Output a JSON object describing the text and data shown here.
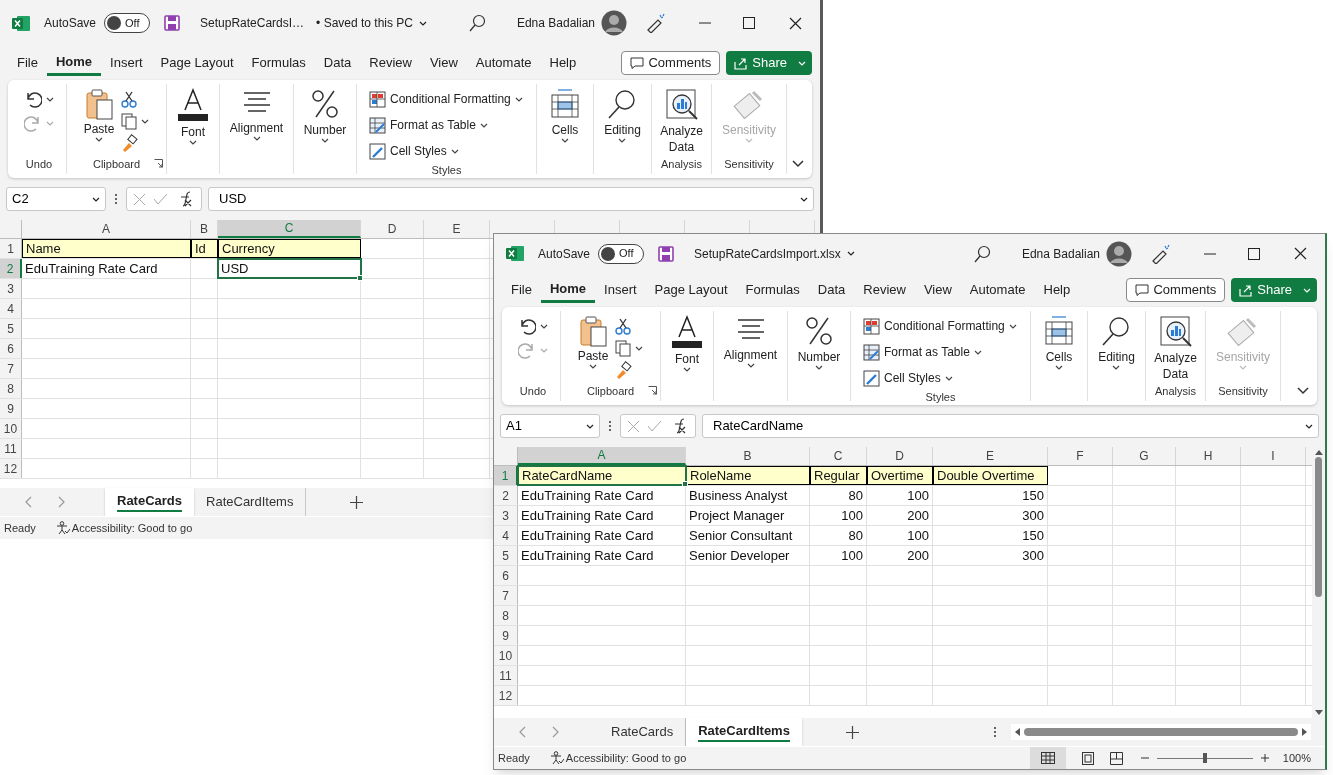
{
  "windows": [
    {
      "autosave": {
        "label": "AutoSave",
        "on": false,
        "state": "Off"
      },
      "filename": "SetupRateCardsI…",
      "save_status": "• Saved to this PC",
      "user": "Edna Badalian",
      "menu_tabs": [
        {
          "label": "File",
          "selected": false
        },
        {
          "label": "Home",
          "selected": true
        },
        {
          "label": "Insert",
          "selected": false
        },
        {
          "label": "Page Layout",
          "selected": false
        },
        {
          "label": "Formulas",
          "selected": false
        },
        {
          "label": "Data",
          "selected": false
        },
        {
          "label": "Review",
          "selected": false
        },
        {
          "label": "View",
          "selected": false
        },
        {
          "label": "Automate",
          "selected": false
        },
        {
          "label": "Help",
          "selected": false
        }
      ],
      "comments": "Comments",
      "share": "Share",
      "ribbon": [
        {
          "kind": "undo",
          "label": "Undo"
        },
        {
          "kind": "clipboard",
          "label": "Clipboard",
          "button": "Paste"
        },
        {
          "kind": "font",
          "button": "Font"
        },
        {
          "kind": "alignment",
          "button": "Alignment"
        },
        {
          "kind": "number",
          "button": "Number"
        },
        {
          "kind": "styles",
          "label": "Styles",
          "items": [
            "Conditional Formatting",
            "Format as Table",
            "Cell Styles"
          ]
        },
        {
          "kind": "cells",
          "button": "Cells"
        },
        {
          "kind": "editing",
          "button": "Editing"
        },
        {
          "kind": "analyze",
          "label": "Analysis",
          "button": "Analyze Data",
          "disabled": false
        },
        {
          "kind": "sensitivity",
          "label": "Sensitivity",
          "button": "Sensitivity",
          "disabled": true
        }
      ],
      "name_box": "C2",
      "formula": "USD",
      "columns": [
        {
          "label": "A",
          "selected": false
        },
        {
          "label": "B",
          "selected": false
        },
        {
          "label": "C",
          "selected": true
        },
        {
          "label": "D",
          "selected": false
        },
        {
          "label": "E",
          "selected": false
        }
      ],
      "rows": [
        {
          "label": "1",
          "selected": false,
          "header": true,
          "cells": [
            "Name",
            "Id",
            "Currency"
          ]
        },
        {
          "label": "2",
          "selected": true,
          "header": false,
          "cells": [
            "EduTraining Rate Card",
            null,
            "USD"
          ]
        },
        {
          "label": "3",
          "selected": false
        },
        {
          "label": "4",
          "selected": false
        },
        {
          "label": "5",
          "selected": false
        },
        {
          "label": "6",
          "selected": false
        },
        {
          "label": "7",
          "selected": false
        },
        {
          "label": "8",
          "selected": false
        },
        {
          "label": "9",
          "selected": false
        },
        {
          "label": "10",
          "selected": false
        },
        {
          "label": "11",
          "selected": false
        },
        {
          "label": "12",
          "selected": false
        }
      ],
      "sheets": [
        {
          "label": "RateCards",
          "selected": true
        },
        {
          "label": "RateCardItems",
          "selected": false
        }
      ],
      "status": "Ready",
      "accessibility": "Accessibility: Good to go"
    },
    {
      "autosave": {
        "label": "AutoSave",
        "on": false,
        "state": "Off"
      },
      "filename": "SetupRateCardsImport.xlsx",
      "user": "Edna Badalian",
      "menu_tabs": [
        {
          "label": "File",
          "selected": false
        },
        {
          "label": "Home",
          "selected": true
        },
        {
          "label": "Insert",
          "selected": false
        },
        {
          "label": "Page Layout",
          "selected": false
        },
        {
          "label": "Formulas",
          "selected": false
        },
        {
          "label": "Data",
          "selected": false
        },
        {
          "label": "Review",
          "selected": false
        },
        {
          "label": "View",
          "selected": false
        },
        {
          "label": "Automate",
          "selected": false
        },
        {
          "label": "Help",
          "selected": false
        }
      ],
      "comments": "Comments",
      "share": "Share",
      "ribbon": [
        {
          "kind": "undo",
          "label": "Undo"
        },
        {
          "kind": "clipboard",
          "label": "Clipboard",
          "button": "Paste"
        },
        {
          "kind": "font",
          "button": "Font"
        },
        {
          "kind": "alignment",
          "button": "Alignment"
        },
        {
          "kind": "number",
          "button": "Number"
        },
        {
          "kind": "styles",
          "label": "Styles",
          "items": [
            "Conditional Formatting",
            "Format as Table",
            "Cell Styles"
          ]
        },
        {
          "kind": "cells",
          "button": "Cells"
        },
        {
          "kind": "editing",
          "button": "Editing"
        },
        {
          "kind": "analyze",
          "label": "Analysis",
          "button": "Analyze Data",
          "disabled": false
        },
        {
          "kind": "sensitivity",
          "label": "Sensitivity",
          "button": "Sensitivity",
          "disabled": true
        }
      ],
      "name_box": "A1",
      "formula": "RateCardName",
      "columns": [
        {
          "label": "A",
          "selected": true
        },
        {
          "label": "B",
          "selected": false
        },
        {
          "label": "C",
          "selected": false,
          "numeric": true
        },
        {
          "label": "D",
          "selected": false,
          "numeric": true
        },
        {
          "label": "E",
          "selected": false,
          "numeric": true
        },
        {
          "label": "F",
          "selected": false
        },
        {
          "label": "G",
          "selected": false
        },
        {
          "label": "H",
          "selected": false
        },
        {
          "label": "I",
          "selected": false
        }
      ],
      "rows": [
        {
          "label": "1",
          "selected": true,
          "header": true,
          "cells": [
            "RateCardName",
            "RoleName",
            "Regular",
            "Overtime",
            "Double Overtime"
          ]
        },
        {
          "label": "2",
          "selected": false,
          "header": false,
          "cells": [
            "EduTraining Rate Card",
            "Business Analyst",
            "80",
            "100",
            "150"
          ]
        },
        {
          "label": "3",
          "selected": false,
          "header": false,
          "cells": [
            "EduTraining Rate Card",
            "Project Manager",
            "100",
            "200",
            "300"
          ]
        },
        {
          "label": "4",
          "selected": false,
          "header": false,
          "cells": [
            "EduTraining Rate Card",
            "Senior Consultant",
            "80",
            "100",
            "150"
          ]
        },
        {
          "label": "5",
          "selected": false,
          "header": false,
          "cells": [
            "EduTraining Rate Card",
            "Senior Developer",
            "100",
            "200",
            "300"
          ]
        },
        {
          "label": "6",
          "selected": false
        },
        {
          "label": "7",
          "selected": false
        },
        {
          "label": "8",
          "selected": false
        },
        {
          "label": "9",
          "selected": false
        },
        {
          "label": "10",
          "selected": false
        },
        {
          "label": "11",
          "selected": false
        },
        {
          "label": "12",
          "selected": false
        }
      ],
      "sheets": [
        {
          "label": "RateCards",
          "selected": false
        },
        {
          "label": "RateCardItems",
          "selected": true
        }
      ],
      "status": "Ready",
      "accessibility": "Accessibility: Good to go",
      "zoom": {
        "level": 0.5,
        "reading": "100%"
      }
    }
  ]
}
